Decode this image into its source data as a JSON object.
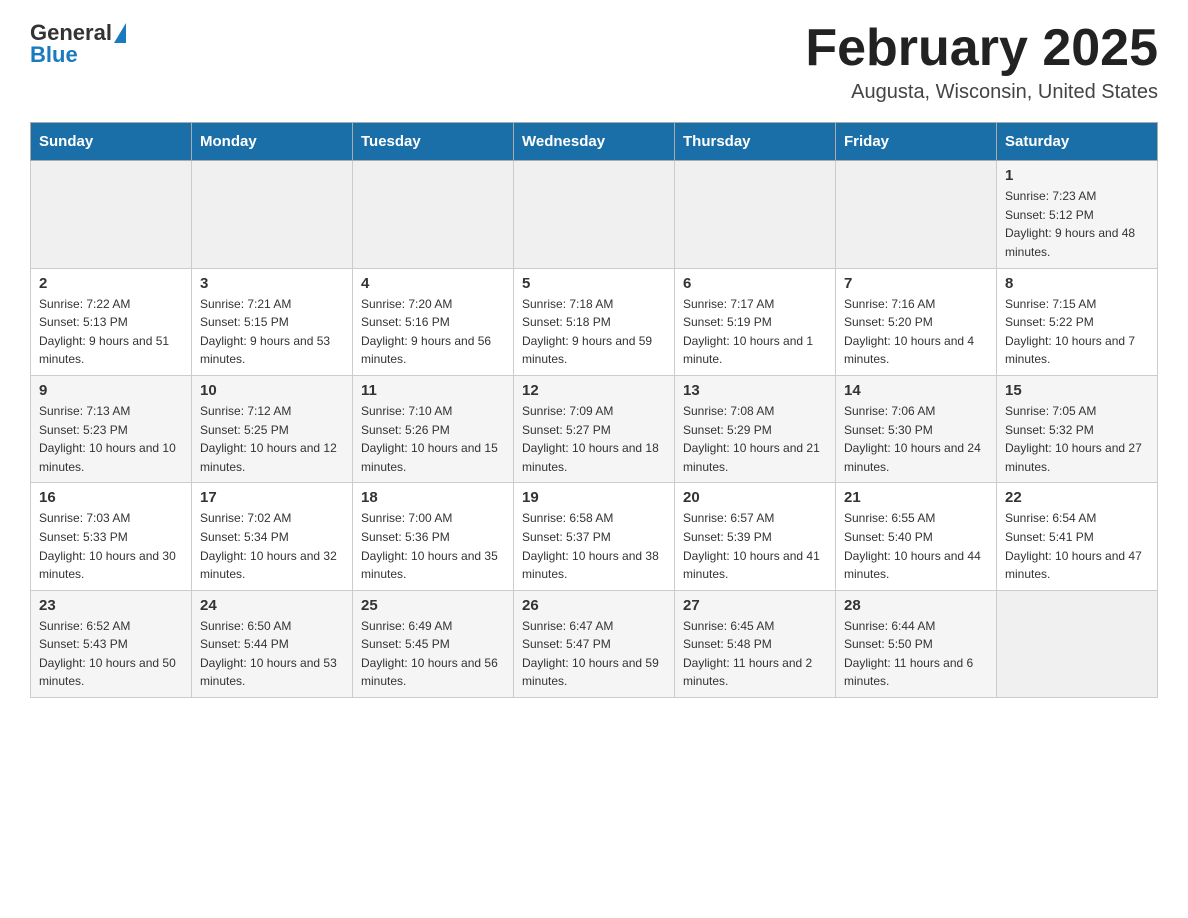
{
  "header": {
    "logo_general": "General",
    "logo_blue": "Blue",
    "month_title": "February 2025",
    "location": "Augusta, Wisconsin, United States"
  },
  "weekdays": [
    "Sunday",
    "Monday",
    "Tuesday",
    "Wednesday",
    "Thursday",
    "Friday",
    "Saturday"
  ],
  "weeks": [
    [
      {
        "day": "",
        "sunrise": "",
        "sunset": "",
        "daylight": ""
      },
      {
        "day": "",
        "sunrise": "",
        "sunset": "",
        "daylight": ""
      },
      {
        "day": "",
        "sunrise": "",
        "sunset": "",
        "daylight": ""
      },
      {
        "day": "",
        "sunrise": "",
        "sunset": "",
        "daylight": ""
      },
      {
        "day": "",
        "sunrise": "",
        "sunset": "",
        "daylight": ""
      },
      {
        "day": "",
        "sunrise": "",
        "sunset": "",
        "daylight": ""
      },
      {
        "day": "1",
        "sunrise": "Sunrise: 7:23 AM",
        "sunset": "Sunset: 5:12 PM",
        "daylight": "Daylight: 9 hours and 48 minutes."
      }
    ],
    [
      {
        "day": "2",
        "sunrise": "Sunrise: 7:22 AM",
        "sunset": "Sunset: 5:13 PM",
        "daylight": "Daylight: 9 hours and 51 minutes."
      },
      {
        "day": "3",
        "sunrise": "Sunrise: 7:21 AM",
        "sunset": "Sunset: 5:15 PM",
        "daylight": "Daylight: 9 hours and 53 minutes."
      },
      {
        "day": "4",
        "sunrise": "Sunrise: 7:20 AM",
        "sunset": "Sunset: 5:16 PM",
        "daylight": "Daylight: 9 hours and 56 minutes."
      },
      {
        "day": "5",
        "sunrise": "Sunrise: 7:18 AM",
        "sunset": "Sunset: 5:18 PM",
        "daylight": "Daylight: 9 hours and 59 minutes."
      },
      {
        "day": "6",
        "sunrise": "Sunrise: 7:17 AM",
        "sunset": "Sunset: 5:19 PM",
        "daylight": "Daylight: 10 hours and 1 minute."
      },
      {
        "day": "7",
        "sunrise": "Sunrise: 7:16 AM",
        "sunset": "Sunset: 5:20 PM",
        "daylight": "Daylight: 10 hours and 4 minutes."
      },
      {
        "day": "8",
        "sunrise": "Sunrise: 7:15 AM",
        "sunset": "Sunset: 5:22 PM",
        "daylight": "Daylight: 10 hours and 7 minutes."
      }
    ],
    [
      {
        "day": "9",
        "sunrise": "Sunrise: 7:13 AM",
        "sunset": "Sunset: 5:23 PM",
        "daylight": "Daylight: 10 hours and 10 minutes."
      },
      {
        "day": "10",
        "sunrise": "Sunrise: 7:12 AM",
        "sunset": "Sunset: 5:25 PM",
        "daylight": "Daylight: 10 hours and 12 minutes."
      },
      {
        "day": "11",
        "sunrise": "Sunrise: 7:10 AM",
        "sunset": "Sunset: 5:26 PM",
        "daylight": "Daylight: 10 hours and 15 minutes."
      },
      {
        "day": "12",
        "sunrise": "Sunrise: 7:09 AM",
        "sunset": "Sunset: 5:27 PM",
        "daylight": "Daylight: 10 hours and 18 minutes."
      },
      {
        "day": "13",
        "sunrise": "Sunrise: 7:08 AM",
        "sunset": "Sunset: 5:29 PM",
        "daylight": "Daylight: 10 hours and 21 minutes."
      },
      {
        "day": "14",
        "sunrise": "Sunrise: 7:06 AM",
        "sunset": "Sunset: 5:30 PM",
        "daylight": "Daylight: 10 hours and 24 minutes."
      },
      {
        "day": "15",
        "sunrise": "Sunrise: 7:05 AM",
        "sunset": "Sunset: 5:32 PM",
        "daylight": "Daylight: 10 hours and 27 minutes."
      }
    ],
    [
      {
        "day": "16",
        "sunrise": "Sunrise: 7:03 AM",
        "sunset": "Sunset: 5:33 PM",
        "daylight": "Daylight: 10 hours and 30 minutes."
      },
      {
        "day": "17",
        "sunrise": "Sunrise: 7:02 AM",
        "sunset": "Sunset: 5:34 PM",
        "daylight": "Daylight: 10 hours and 32 minutes."
      },
      {
        "day": "18",
        "sunrise": "Sunrise: 7:00 AM",
        "sunset": "Sunset: 5:36 PM",
        "daylight": "Daylight: 10 hours and 35 minutes."
      },
      {
        "day": "19",
        "sunrise": "Sunrise: 6:58 AM",
        "sunset": "Sunset: 5:37 PM",
        "daylight": "Daylight: 10 hours and 38 minutes."
      },
      {
        "day": "20",
        "sunrise": "Sunrise: 6:57 AM",
        "sunset": "Sunset: 5:39 PM",
        "daylight": "Daylight: 10 hours and 41 minutes."
      },
      {
        "day": "21",
        "sunrise": "Sunrise: 6:55 AM",
        "sunset": "Sunset: 5:40 PM",
        "daylight": "Daylight: 10 hours and 44 minutes."
      },
      {
        "day": "22",
        "sunrise": "Sunrise: 6:54 AM",
        "sunset": "Sunset: 5:41 PM",
        "daylight": "Daylight: 10 hours and 47 minutes."
      }
    ],
    [
      {
        "day": "23",
        "sunrise": "Sunrise: 6:52 AM",
        "sunset": "Sunset: 5:43 PM",
        "daylight": "Daylight: 10 hours and 50 minutes."
      },
      {
        "day": "24",
        "sunrise": "Sunrise: 6:50 AM",
        "sunset": "Sunset: 5:44 PM",
        "daylight": "Daylight: 10 hours and 53 minutes."
      },
      {
        "day": "25",
        "sunrise": "Sunrise: 6:49 AM",
        "sunset": "Sunset: 5:45 PM",
        "daylight": "Daylight: 10 hours and 56 minutes."
      },
      {
        "day": "26",
        "sunrise": "Sunrise: 6:47 AM",
        "sunset": "Sunset: 5:47 PM",
        "daylight": "Daylight: 10 hours and 59 minutes."
      },
      {
        "day": "27",
        "sunrise": "Sunrise: 6:45 AM",
        "sunset": "Sunset: 5:48 PM",
        "daylight": "Daylight: 11 hours and 2 minutes."
      },
      {
        "day": "28",
        "sunrise": "Sunrise: 6:44 AM",
        "sunset": "Sunset: 5:50 PM",
        "daylight": "Daylight: 11 hours and 6 minutes."
      },
      {
        "day": "",
        "sunrise": "",
        "sunset": "",
        "daylight": ""
      }
    ]
  ]
}
